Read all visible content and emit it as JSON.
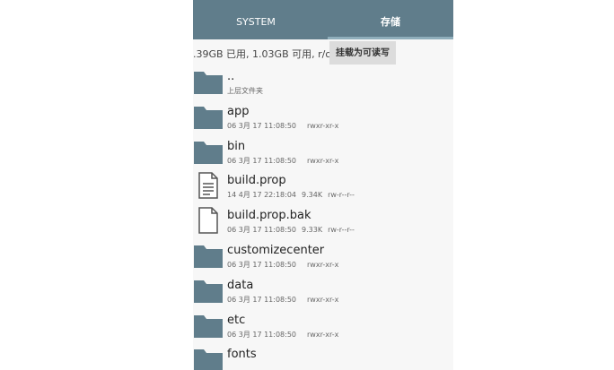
{
  "tabs": [
    {
      "label": "SYSTEM",
      "selected": false
    },
    {
      "label": "存储",
      "selected": true
    }
  ],
  "storage_info": ".39GB 已用, 1.03GB 可用, r/o",
  "mount_button": "挂载为可读写",
  "files": [
    {
      "name": "..",
      "date": "上层文件夹",
      "size": "",
      "perm": "",
      "type": "folder"
    },
    {
      "name": "app",
      "date": "06 3月 17 11:08:50",
      "size": "",
      "perm": "rwxr-xr-x",
      "type": "folder"
    },
    {
      "name": "bin",
      "date": "06 3月 17 11:08:50",
      "size": "",
      "perm": "rwxr-xr-x",
      "type": "folder"
    },
    {
      "name": "build.prop",
      "date": "14 4月 17 22:18:04",
      "size": "9.34K",
      "perm": "rw-r--r--",
      "type": "text-file"
    },
    {
      "name": "build.prop.bak",
      "date": "06 3月 17 11:08:50",
      "size": "9.33K",
      "perm": "rw-r--r--",
      "type": "file"
    },
    {
      "name": "customizecenter",
      "date": "06 3月 17 11:08:50",
      "size": "",
      "perm": "rwxr-xr-x",
      "type": "folder"
    },
    {
      "name": "data",
      "date": "06 3月 17 11:08:50",
      "size": "",
      "perm": "rwxr-xr-x",
      "type": "folder"
    },
    {
      "name": "etc",
      "date": "06 3月 17 11:08:50",
      "size": "",
      "perm": "rwxr-xr-x",
      "type": "folder"
    },
    {
      "name": "fonts",
      "date": "",
      "size": "",
      "perm": "",
      "type": "folder"
    }
  ],
  "colors": {
    "toolbar": "#607d8b",
    "folder": "#607d8b"
  }
}
